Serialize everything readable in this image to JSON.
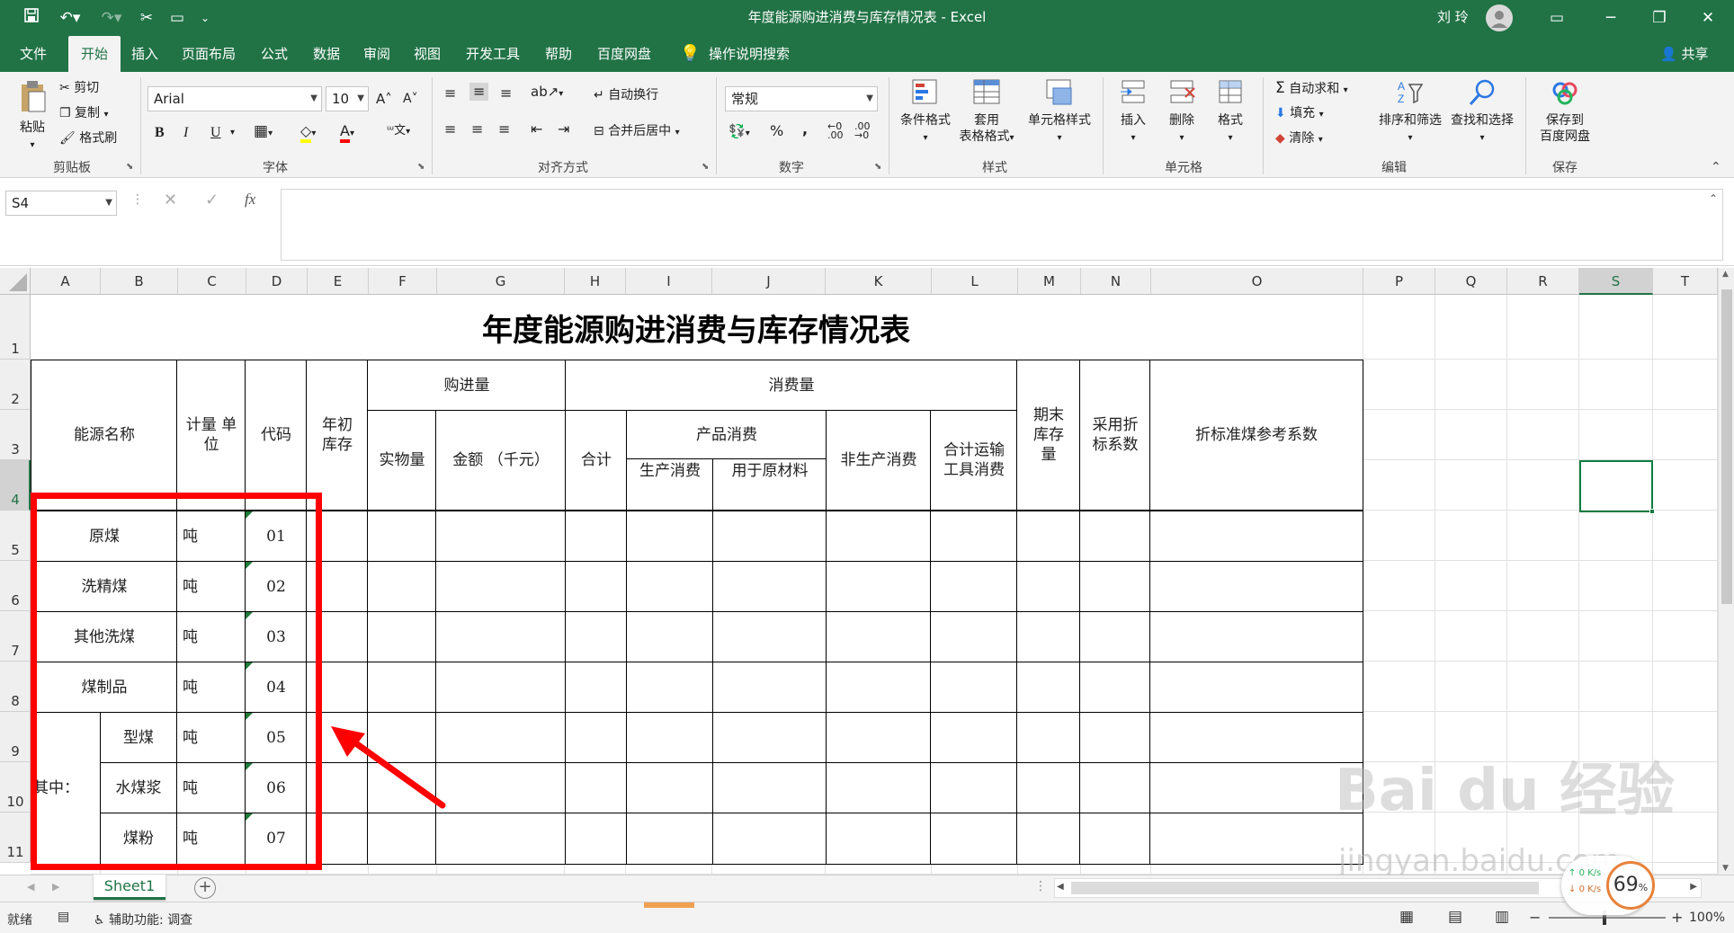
{
  "window": {
    "title": "年度能源购进消费与库存情况表  -  Excel",
    "user": "刘 玲"
  },
  "ribbon_tabs": [
    "文件",
    "开始",
    "插入",
    "页面布局",
    "公式",
    "数据",
    "审阅",
    "视图",
    "开发工具",
    "帮助",
    "百度网盘"
  ],
  "active_tab": "开始",
  "tell_me": "操作说明搜索",
  "share": "共享",
  "clipboard": {
    "paste": "粘贴",
    "cut": "剪切",
    "copy": "复制",
    "format_painter": "格式刷",
    "label": "剪贴板"
  },
  "font": {
    "name": "Arial",
    "size": "10",
    "bold": "B",
    "italic": "I",
    "underline": "U",
    "label": "字体"
  },
  "alignment": {
    "wrap": "自动换行",
    "merge": "合并后居中",
    "label": "对齐方式"
  },
  "number": {
    "format": "常规",
    "percent": "%",
    "comma": ",",
    "label": "数字"
  },
  "styles": {
    "conditional": "条件格式",
    "table_line1": "套用",
    "table_line2": "表格格式",
    "cell_styles": "单元格样式",
    "label": "样式"
  },
  "cells": {
    "insert": "插入",
    "delete": "删除",
    "format": "格式",
    "label": "单元格"
  },
  "editing": {
    "autosum": "自动求和",
    "fill": "填充",
    "clear": "清除",
    "sort": "排序和筛选",
    "find": "查找和选择",
    "label": "编辑"
  },
  "save": {
    "line1": "保存到",
    "line2": "百度网盘",
    "label": "保存"
  },
  "formula_bar": {
    "name_box": "S4",
    "fx": "fx",
    "content": ""
  },
  "columns": [
    "A",
    "B",
    "C",
    "D",
    "E",
    "F",
    "G",
    "H",
    "I",
    "J",
    "K",
    "L",
    "M",
    "N",
    "O",
    "P",
    "Q",
    "R",
    "S",
    "T"
  ],
  "rows": [
    "1",
    "2",
    "3",
    "4",
    "5",
    "6",
    "7",
    "8",
    "9",
    "10",
    "11"
  ],
  "table": {
    "title": "年度能源购进消费与库存情况表",
    "h_energy_name": "能源名称",
    "h_unit": "计量 单位",
    "h_code": "代码",
    "h_opening_stock": "年初库存",
    "h_purchase": "购进量",
    "h_physical": "实物量",
    "h_amount": "金额 （千元）",
    "h_consumption": "消费量",
    "h_total": "合计",
    "h_product_consumption": "产品消费",
    "h_production": "生产消费",
    "h_raw_material": "用于原材料",
    "h_non_production": "非生产消费",
    "h_transport": "合计运输工具消费",
    "h_closing_stock": "期末库存量",
    "h_coef": "采用折标系数",
    "h_ref_coef": "折标准煤参考系数",
    "among": "其中：",
    "items": [
      {
        "name": "原煤",
        "unit": "吨",
        "code": "01"
      },
      {
        "name": "洗精煤",
        "unit": "吨",
        "code": "02"
      },
      {
        "name": "其他洗煤",
        "unit": "吨",
        "code": "03"
      },
      {
        "name": "煤制品",
        "unit": "吨",
        "code": "04"
      },
      {
        "name": "型煤",
        "unit": "吨",
        "code": "05"
      },
      {
        "name": "水煤浆",
        "unit": "吨",
        "code": "06"
      },
      {
        "name": "煤粉",
        "unit": "吨",
        "code": "07"
      }
    ]
  },
  "sheet_tabs": [
    "Sheet1"
  ],
  "status": {
    "ready": "就绪",
    "accessibility": "辅助功能: 调查",
    "zoom": "100%"
  },
  "watermark": {
    "brand": "Bai du 经验",
    "url": "jingyan.baidu.com"
  },
  "speed": {
    "up": "0 K/s",
    "down": "0 K/s",
    "percent": "69"
  },
  "colors": {
    "excel_green": "#217346",
    "highlight_red": "#ff0000",
    "active_cell": "#107c41"
  }
}
